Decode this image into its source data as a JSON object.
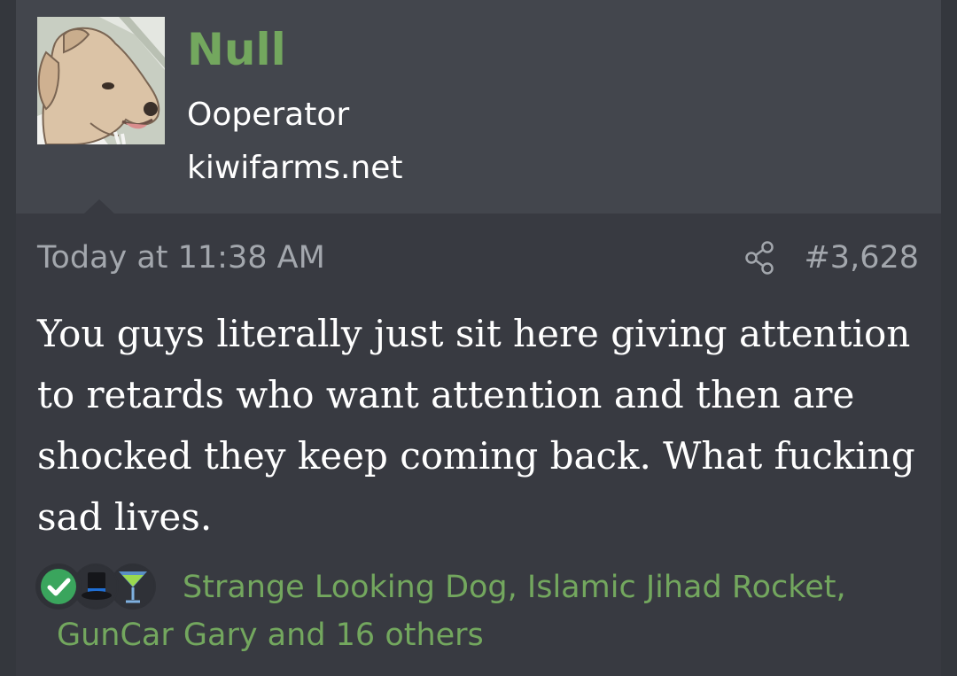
{
  "user": {
    "name": "Null",
    "title": "Ooperator",
    "site": "kiwifarms.net",
    "avatar_icon": "dog-avatar"
  },
  "post": {
    "time": "Today at 11:38 AM",
    "number": "#3,628",
    "share_icon": "share-icon",
    "message": "You guys literally just sit here giving attention to retards who want attention and then are shocked they keep coming back. What fucking sad lives."
  },
  "reactions": {
    "icons": [
      "check-icon",
      "top-hat-icon",
      "cocktail-icon"
    ],
    "users_text": "Strange Looking Dog, Islamic Jihad Rocket, GunCar Gary and 16 others"
  },
  "colors": {
    "background": "#34373d",
    "post_bg": "#383a41",
    "user_block_bg": "#43464d",
    "username": "#73a75e",
    "meta_text": "#a3a7ad",
    "reaction_link": "#73a75e"
  }
}
